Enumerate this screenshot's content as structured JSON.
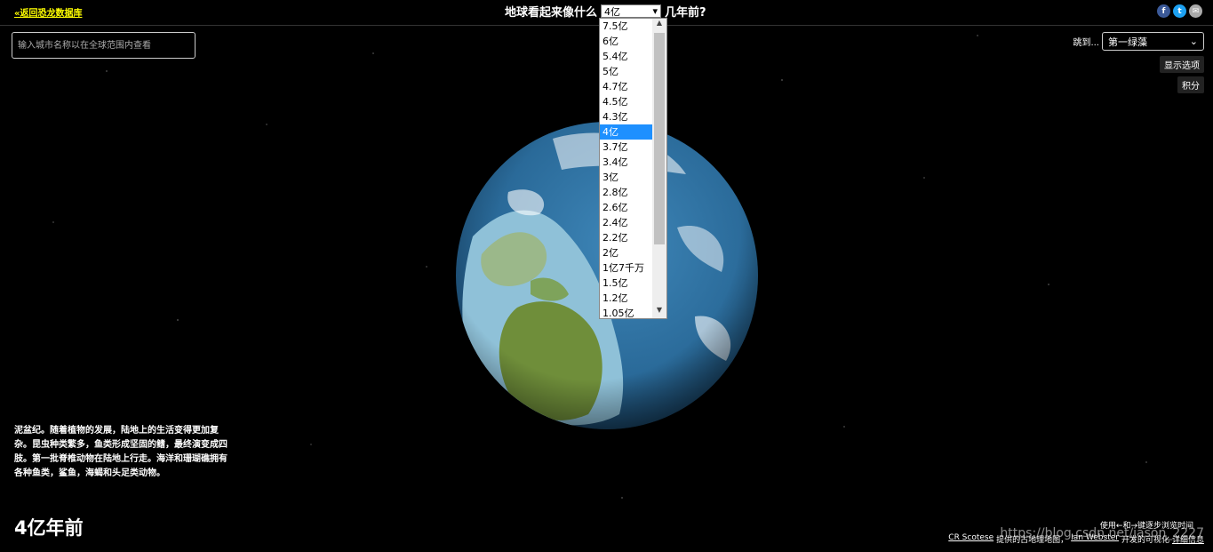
{
  "top": {
    "back_link": "«返回恐龙数据库",
    "title_prefix": "地球看起来像什么",
    "selected_age": "4亿",
    "title_suffix": "几年前?"
  },
  "social": {
    "facebook": "f",
    "twitter": "t",
    "email": "✉"
  },
  "search": {
    "placeholder": "输入城市名称以在全球范围内查看"
  },
  "jump": {
    "label": "跳到...",
    "selected": "第一绿藻"
  },
  "buttons": {
    "show_options": "显示选项",
    "credits": "积分"
  },
  "dropdown": {
    "options": [
      "7.5亿",
      "6亿",
      "5.4亿",
      "5亿",
      "4.7亿",
      "4.5亿",
      "4.3亿",
      "4亿",
      "3.7亿",
      "3.4亿",
      "3亿",
      "2.8亿",
      "2.6亿",
      "2.4亿",
      "2.2亿",
      "2亿",
      "1亿7千万",
      "1.5亿",
      "1.2亿",
      "1.05亿"
    ],
    "selected_index": 7
  },
  "description": "泥盆纪。随着植物的发展，陆地上的生活变得更加复杂。昆虫种类繁多，鱼类形成坚固的鳍，最终演变成四肢。第一批脊椎动物在陆地上行走。海洋和珊瑚礁拥有各种鱼类，鲨鱼，海蝎和头足类动物。",
  "age_label": "4亿年前",
  "footer": {
    "hint": "使用←和→键逐步浏览时间",
    "cr_link": "CR Scotese",
    "cr_text": "提供的古地理地图，",
    "ian_link": "Ian Webster",
    "ian_text": "开发的可视化",
    "detail_link": "详细信息"
  },
  "watermark": "https://blog.csdn.net/jason_2227",
  "colors": {
    "ocean": "#2f6f9f",
    "land_green": "#6f8e3a",
    "shallow": "#8fc1d8",
    "highlight": "#1e90ff",
    "link_yellow": "#ffff00"
  }
}
